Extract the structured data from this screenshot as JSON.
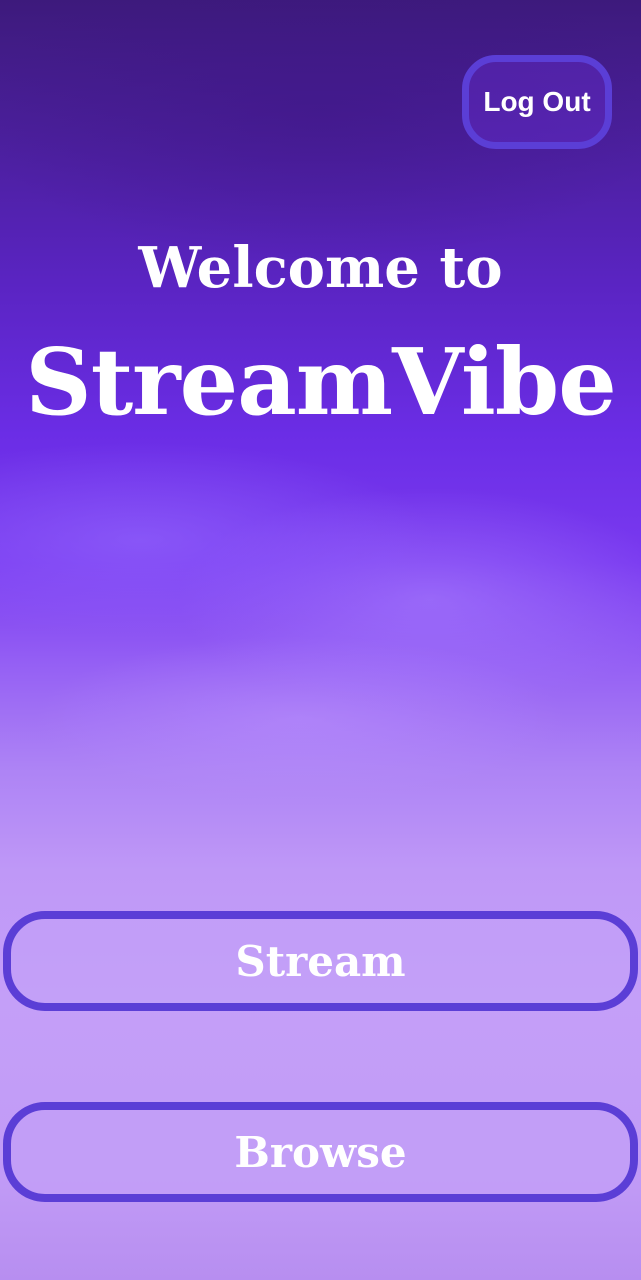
{
  "header": {
    "logout_label": "Log Out"
  },
  "hero": {
    "welcome_text": "Welcome to",
    "app_name": "StreamVibe"
  },
  "actions": {
    "stream_label": "Stream",
    "browse_label": "Browse"
  },
  "colors": {
    "accent_border": "#5b3ed6",
    "background_top": "#3d1a7c",
    "background_mid": "#6b2de6",
    "background_bottom": "#c49ff8",
    "text": "#ffffff"
  }
}
